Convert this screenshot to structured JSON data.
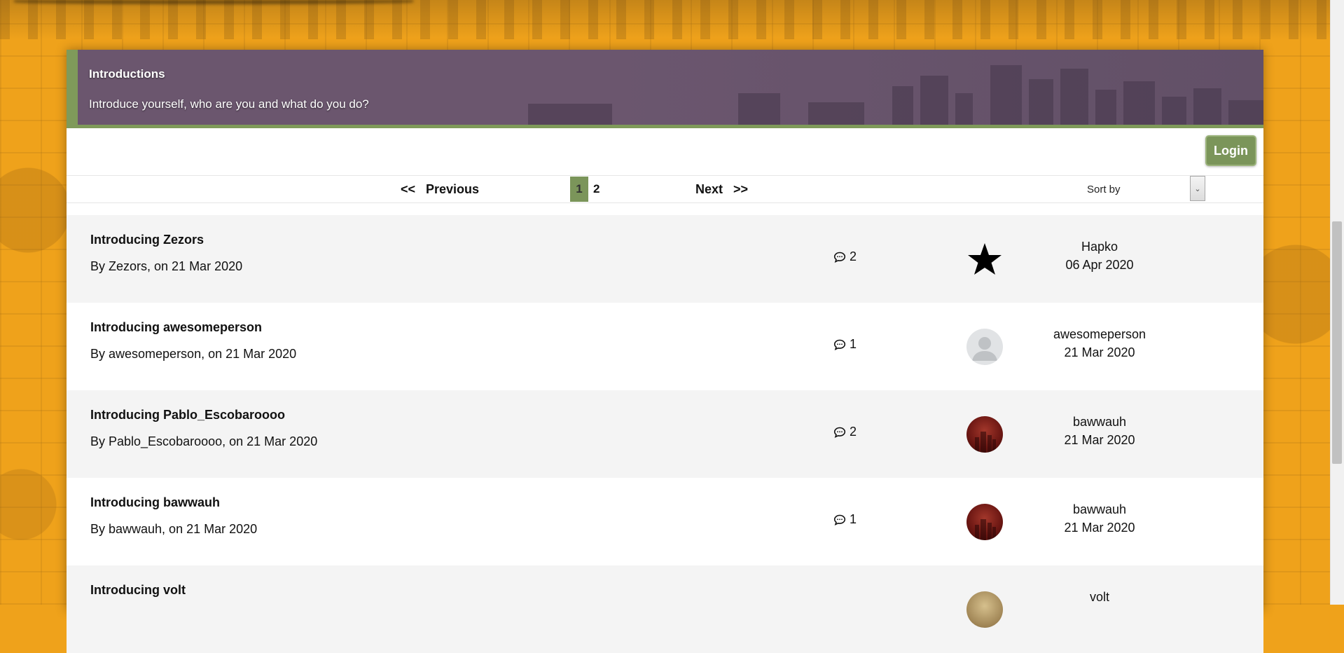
{
  "forum": {
    "title": "Introductions",
    "description": "Introduce yourself, who are you and what do you do?"
  },
  "login_label": "Login",
  "pager": {
    "previous": "<<   Previous",
    "next": "Next   >>",
    "current_page": "1",
    "other_page": "2",
    "sort_label": "Sort by"
  },
  "topics": [
    {
      "title": "Introducing Zezors",
      "byline": "By Zezors, on 21 Mar 2020",
      "replies": "2",
      "avatar": "star-icon",
      "last_user": "Hapko",
      "last_date": "06 Apr 2020"
    },
    {
      "title": "Introducing awesomeperson",
      "byline": "By awesomeperson, on 21 Mar 2020",
      "replies": "1",
      "avatar": "default-avatar",
      "last_user": "awesomeperson",
      "last_date": "21 Mar 2020"
    },
    {
      "title": "Introducing Pablo_Escobaroooo",
      "byline": "By Pablo_Escobaroooo, on 21 Mar 2020",
      "replies": "2",
      "avatar": "city-avatar",
      "last_user": "bawwauh",
      "last_date": "21 Mar 2020"
    },
    {
      "title": "Introducing bawwauh",
      "byline": "By bawwauh, on 21 Mar 2020",
      "replies": "1",
      "avatar": "city-avatar",
      "last_user": "bawwauh",
      "last_date": "21 Mar 2020"
    },
    {
      "title": "Introducing volt",
      "byline": "",
      "replies": "",
      "avatar": "photo-avatar",
      "last_user": "volt",
      "last_date": ""
    }
  ],
  "colors": {
    "background": "#efa21b",
    "banner": "#6b5670",
    "accent_green": "#7b955a"
  }
}
